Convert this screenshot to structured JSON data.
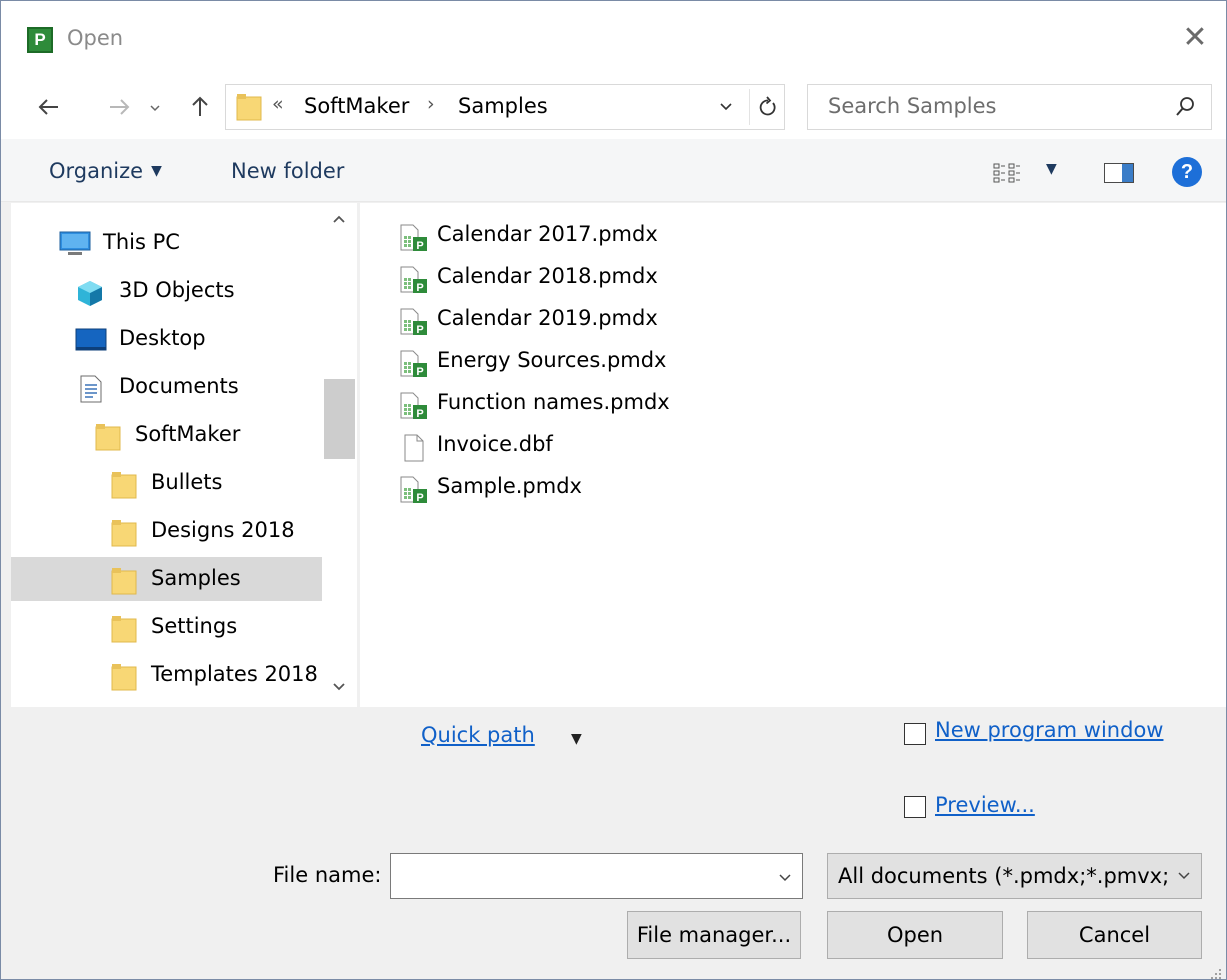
{
  "window": {
    "app_icon_letter": "P",
    "title": "Open",
    "close_glyph": "✕"
  },
  "nav": {
    "back_icon": "back-arrow-icon",
    "forward_icon": "forward-arrow-icon",
    "recent_icon": "chevron-down-icon",
    "up_icon": "up-arrow-icon",
    "address_overflow": "«",
    "breadcrumbs": [
      "SoftMaker",
      "Samples"
    ],
    "search_placeholder": "Search Samples"
  },
  "commands": {
    "organize": "Organize",
    "new_folder": "New folder"
  },
  "tree": [
    {
      "label": "This PC",
      "icon": "computer-icon",
      "level": 0
    },
    {
      "label": "3D Objects",
      "icon": "3d-objects-icon",
      "level": 1
    },
    {
      "label": "Desktop",
      "icon": "desktop-icon",
      "level": 1
    },
    {
      "label": "Documents",
      "icon": "documents-icon",
      "level": 1
    },
    {
      "label": "SoftMaker",
      "icon": "folder-icon",
      "level": 2
    },
    {
      "label": "Bullets",
      "icon": "folder-icon",
      "level": 3
    },
    {
      "label": "Designs 2018",
      "icon": "folder-icon",
      "level": 3
    },
    {
      "label": "Samples",
      "icon": "folder-icon",
      "level": 3,
      "selected": true
    },
    {
      "label": "Settings",
      "icon": "folder-icon",
      "level": 3
    },
    {
      "label": "Templates 2018",
      "icon": "folder-icon",
      "level": 3
    }
  ],
  "files": [
    {
      "name": "Calendar 2017.pmdx",
      "type": "pmdx"
    },
    {
      "name": "Calendar 2018.pmdx",
      "type": "pmdx"
    },
    {
      "name": "Calendar 2019.pmdx",
      "type": "pmdx"
    },
    {
      "name": "Energy Sources.pmdx",
      "type": "pmdx"
    },
    {
      "name": "Function names.pmdx",
      "type": "pmdx"
    },
    {
      "name": "Invoice.dbf",
      "type": "generic"
    },
    {
      "name": "Sample.pmdx",
      "type": "pmdx"
    }
  ],
  "options": {
    "quick_path": "Quick path",
    "new_program_window": "New program window",
    "new_program_window_checked": false,
    "preview": "Preview...",
    "preview_checked": false
  },
  "file_name": {
    "label": "File name:",
    "value": ""
  },
  "file_type": "All documents (*.pmdx;*.pmvx;",
  "buttons": {
    "file_manager": "File manager...",
    "open": "Open",
    "cancel": "Cancel"
  },
  "colors": {
    "accent_link": "#1060c8",
    "selection": "#d9d9d9",
    "app_icon": "#2e8b3a",
    "help_icon": "#1d6fd8",
    "folder": "#f8d775"
  }
}
